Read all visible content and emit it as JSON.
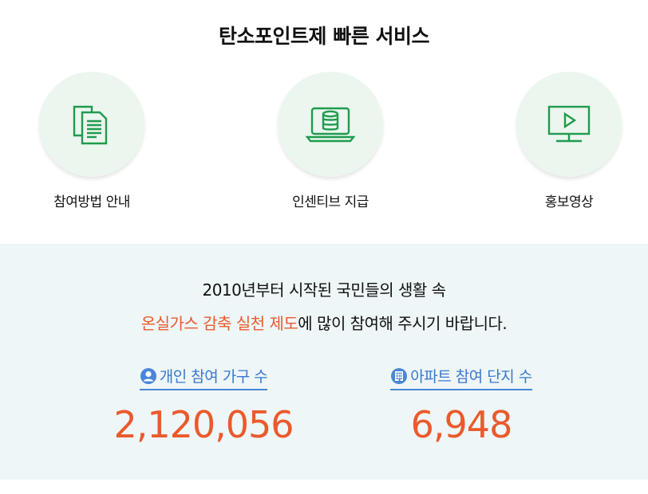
{
  "services": {
    "title": "탄소포인트제 빠른 서비스",
    "items": [
      {
        "label": "참여방법 안내",
        "icon": "documents-icon"
      },
      {
        "label": "인센티브 지급",
        "icon": "laptop-coins-icon"
      },
      {
        "label": "홍보영상",
        "icon": "video-monitor-icon"
      }
    ]
  },
  "intro": {
    "line1": "2010년부터 시작된 국민들의 생활 속",
    "line2_highlight": "온실가스 감축 실천 제도",
    "line2_rest": "에 많이 참여해 주시기 바랍니다."
  },
  "stats": {
    "individual": {
      "label": "개인 참여 가구 수",
      "value": "2,120,056",
      "icon": "person-icon"
    },
    "apartment": {
      "label": "아파트 참여 단지 수",
      "value": "6,948",
      "icon": "building-icon"
    }
  },
  "colors": {
    "accent_green": "#1f9b4e",
    "circle_bg": "#ebf6ee",
    "highlight_orange": "#ec5a2c",
    "stat_blue": "#3a78cf",
    "panel_bg": "#eef6f7"
  }
}
